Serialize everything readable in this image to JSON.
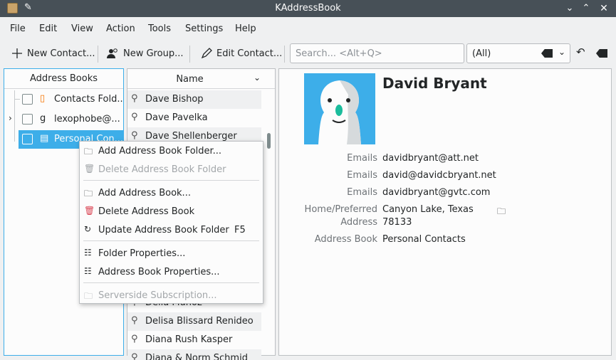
{
  "window": {
    "title": "KAddressBook",
    "icon": "kaddressbook-app-icon"
  },
  "menu": [
    "File",
    "Edit",
    "View",
    "Action",
    "Tools",
    "Settings",
    "Help"
  ],
  "toolbar": {
    "new_contact": "New Contact...",
    "new_group": "New Group...",
    "edit_contact": "Edit Contact...",
    "search_placeholder": "Search... <Alt+Q>",
    "filter_value": "(All)"
  },
  "address_books": {
    "header": "Address Books",
    "items": [
      {
        "label": "Contacts Fold..."
      },
      {
        "label": "lexophobe@..."
      },
      {
        "label": "Personal Con..."
      }
    ]
  },
  "contact_list": {
    "header": "Name",
    "rows": [
      "Dave Bishop",
      "Dave Pavelka",
      "Dave Shellenberger",
      "Delia Muñoz",
      "Delisa Blissard Renideo",
      "Diana Rush Kasper",
      "Diana & Norm Schmid"
    ]
  },
  "context_menu": {
    "items": [
      {
        "label": "Add Address Book Folder...",
        "enabled": true,
        "icon": "folder-add-icon"
      },
      {
        "label": "Delete Address Book Folder",
        "enabled": false,
        "icon": "trash-icon"
      },
      {
        "label": "Add Address Book...",
        "enabled": true,
        "icon": "folder-add-icon"
      },
      {
        "label": "Delete Address Book",
        "enabled": true,
        "icon": "trash-red-icon"
      },
      {
        "label": "Update Address Book Folder",
        "shortcut": "F5",
        "enabled": true,
        "icon": "refresh-icon"
      },
      {
        "label": "Folder Properties...",
        "enabled": true,
        "icon": "properties-icon"
      },
      {
        "label": "Address Book Properties...",
        "enabled": true,
        "icon": "properties-icon"
      },
      {
        "label": "Serverside Subscription...",
        "enabled": false,
        "icon": "folder-icon"
      }
    ]
  },
  "contact": {
    "name": "David Bryant",
    "fields": [
      {
        "label": "Emails",
        "value": "davidbryant@att.net"
      },
      {
        "label": "Emails",
        "value": "david@davidcbryant.net"
      },
      {
        "label": "Emails",
        "value": "davidbryant@gvtc.com"
      },
      {
        "label": "Home/Preferred",
        "label2": "Address",
        "value": "Canyon Lake, Texas",
        "value2": "78133"
      },
      {
        "label": "Address Book",
        "value": "Personal Contacts"
      }
    ]
  },
  "colors": {
    "accent": "#3daee9",
    "titlebar": "#475057",
    "delete_red": "#da4453"
  }
}
